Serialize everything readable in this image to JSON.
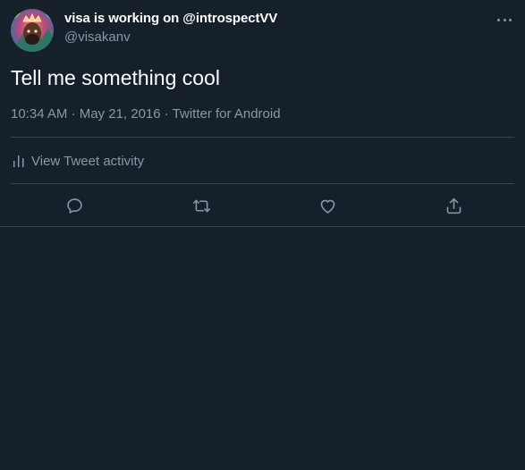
{
  "theme": {
    "background": "#15202b",
    "text_primary": "#ffffff",
    "text_secondary": "#8899a6",
    "divider": "#38444d"
  },
  "author": {
    "display_name": "visa is working on @introspectVV",
    "handle": "@visakanv",
    "avatar_icon": "profile-avatar"
  },
  "tweet": {
    "text": "Tell me something cool",
    "meta": "10:34 AM · May 21, 2016 · Twitter for Android"
  },
  "activity": {
    "label": "View Tweet activity",
    "icon": "bar-chart-icon"
  },
  "actions": [
    {
      "name": "reply",
      "icon": "reply-icon"
    },
    {
      "name": "retweet",
      "icon": "retweet-icon"
    },
    {
      "name": "like",
      "icon": "heart-icon"
    },
    {
      "name": "share",
      "icon": "share-icon"
    }
  ],
  "more_menu": {
    "icon": "more-icon"
  }
}
